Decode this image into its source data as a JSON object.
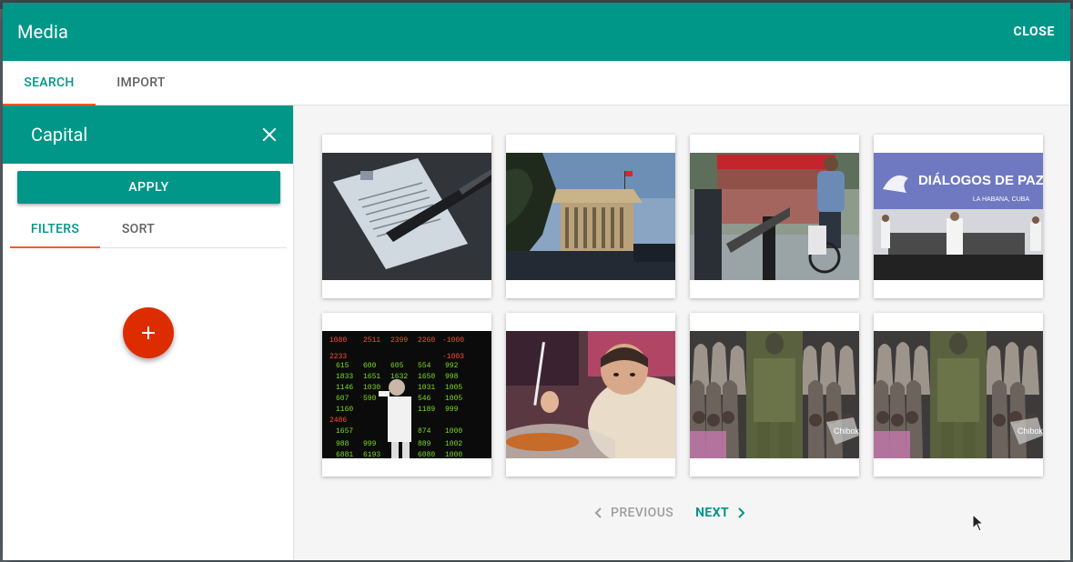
{
  "dialog": {
    "title": "Media",
    "close_label": "CLOSE"
  },
  "tabs": {
    "search": "SEARCH",
    "import": "IMPORT"
  },
  "sidebar": {
    "title": "Capital",
    "apply_label": "APPLY",
    "tabs": {
      "filters": "FILTERS",
      "sort": "SORT"
    }
  },
  "grid": {
    "images": [
      {
        "name": "document-paper-photo"
      },
      {
        "name": "government-building-photo"
      },
      {
        "name": "cyclist-street-photo"
      },
      {
        "name": "peace-dialogue-banner-photo",
        "banner_text": "DIÁLOGOS DE PAZ",
        "banner_subtext": "LA HABANA, CUBA"
      },
      {
        "name": "stock-ticker-board-photo"
      },
      {
        "name": "child-eating-photo"
      },
      {
        "name": "group-of-girls-photo-1",
        "overlay_text": "Chibok"
      },
      {
        "name": "group-of-girls-photo-2",
        "overlay_text": "Chibok"
      }
    ]
  },
  "pagination": {
    "previous_label": "PREVIOUS",
    "next_label": "NEXT"
  },
  "colors": {
    "primary": "#009688",
    "accent": "#ff5722",
    "fab": "#dd2c00"
  }
}
